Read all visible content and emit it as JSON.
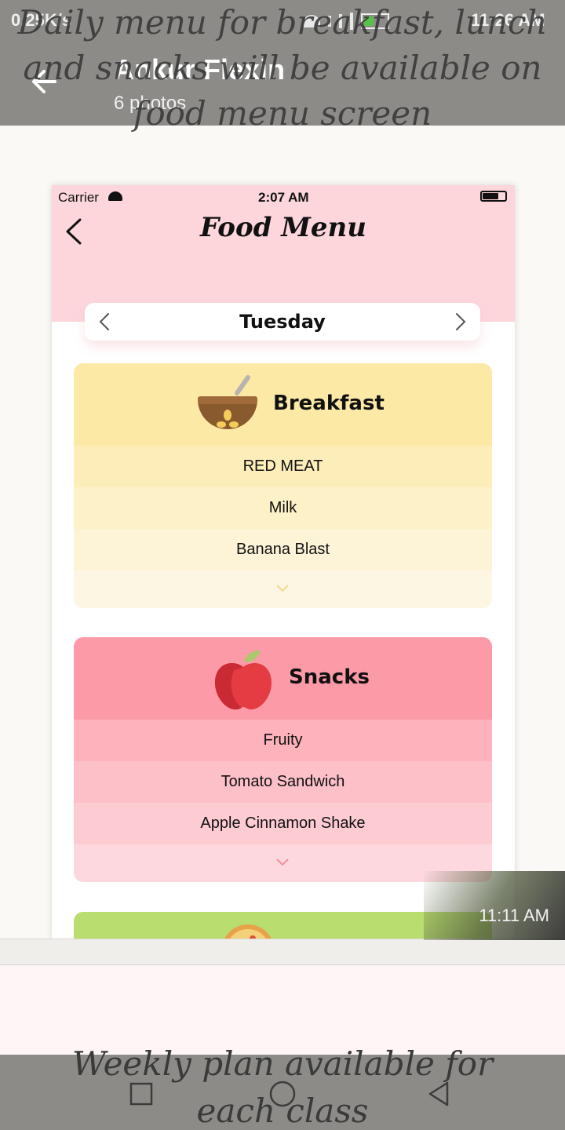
{
  "status_bar": {
    "network_speed": "0.25K/s",
    "time": "11:26 AM",
    "icons": [
      "screenshot-icon",
      "mail-icon",
      "alert-icon",
      "mute-icon",
      "wifi-icon",
      "volte-icon",
      "signal-icon",
      "signal-icon-2",
      "battery-icon"
    ]
  },
  "header": {
    "title": "Ankur Flexin",
    "subtitle": "6 photos"
  },
  "caption_top": "Daily menu for breakfast, lunch and snacks will be available on food menu screen",
  "caption_bottom": "Weekly plan available for each class",
  "screenshot": {
    "ios_status": {
      "carrier": "Carrier",
      "time": "2:07 AM"
    },
    "title": "Food Menu",
    "day": "Tuesday",
    "meals": [
      {
        "name": "Breakfast",
        "icon": "bowl-icon",
        "header_color": "#fde9a6",
        "row_colors": [
          "#fdedb9",
          "#fdf1c8",
          "#fdf4d7",
          "#fdf6e3"
        ],
        "items": [
          "RED MEAT",
          "Milk",
          "Banana Blast"
        ]
      },
      {
        "name": "Snacks",
        "icon": "apple-icon",
        "header_color": "#fd9aa7",
        "row_colors": [
          "#fdb2bc",
          "#fdc0c8",
          "#fdcbd2",
          "#fdd8de"
        ],
        "items": [
          "Fruity",
          "Tomato Sandwich",
          "Apple Cinnamon Shake"
        ]
      }
    ],
    "third_card_color": "#b9dd6e",
    "third_card_icon": "pizza-icon"
  },
  "photo_time": "11:11 AM",
  "nav": {
    "icons": [
      "recent-apps-icon",
      "home-icon",
      "back-icon"
    ]
  }
}
